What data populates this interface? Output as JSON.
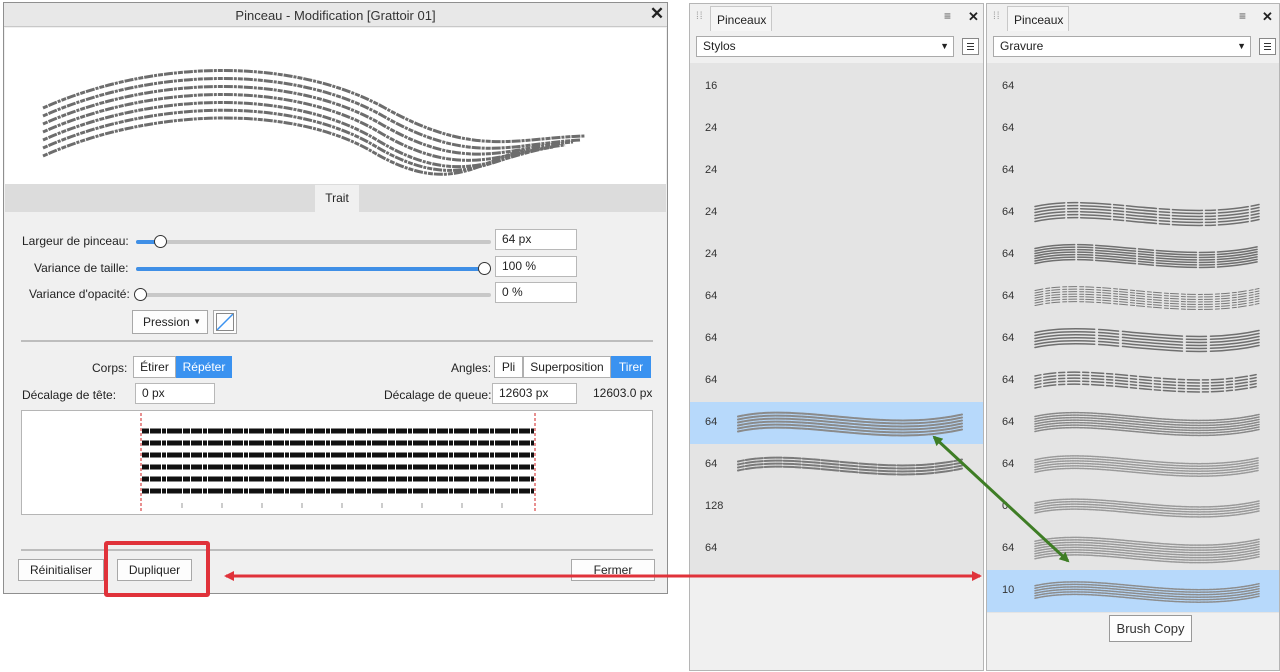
{
  "dialog": {
    "title": "Pinceau - Modification [Grattoir 01]",
    "close_label": "✕",
    "tab_label": "Trait",
    "sliders": [
      {
        "label": "Largeur de pinceau:",
        "value": "64 px",
        "level": 0.05
      },
      {
        "label": "Variance de taille:",
        "value": "100 %",
        "level": 1.0
      },
      {
        "label": "Variance d'opacité:",
        "value": "0 %",
        "level": 0.0
      }
    ],
    "pressure_label": "Pression",
    "body_label": "Corps:",
    "body_options": [
      "Étirer",
      "Répéter"
    ],
    "body_selected": "Répéter",
    "angles_label": "Angles:",
    "angles_options": [
      "Pli",
      "Superposition",
      "Tirer"
    ],
    "angles_selected": "Tirer",
    "head_offset_label": "Décalage de tête:",
    "head_offset_value": "0 px",
    "tail_offset_label": "Décalage de queue:",
    "tail_offset_value": "12603 px",
    "tail_offset_readout": "12603.0 px",
    "reset_label": "Réinitialiser",
    "duplicate_label": "Dupliquer",
    "close_button_label": "Fermer"
  },
  "panel_left": {
    "tab_label": "Pinceaux",
    "menu_icon": "≡",
    "close_label": "✕",
    "category": "Stylos",
    "sizes": [
      "16",
      "24",
      "24",
      "24",
      "24",
      "64",
      "64",
      "64",
      "64",
      "64",
      "128",
      "64"
    ],
    "selected_index": 8
  },
  "panel_right": {
    "tab_label": "Pinceaux",
    "menu_icon": "≡",
    "close_label": "✕",
    "category": "Gravure",
    "sizes": [
      "64",
      "64",
      "64",
      "64",
      "64",
      "64",
      "64",
      "64",
      "64",
      "64",
      "0",
      "64",
      "10"
    ],
    "selected_index": 12,
    "brush_copy_label": "Brush Copy"
  },
  "colors": {
    "accent": "#3a92f0",
    "highlight_box": "#e0323a",
    "red_arrow": "#e0323a",
    "green_arrow": "#3e7d25",
    "selected_row": "#b7d9fb"
  }
}
